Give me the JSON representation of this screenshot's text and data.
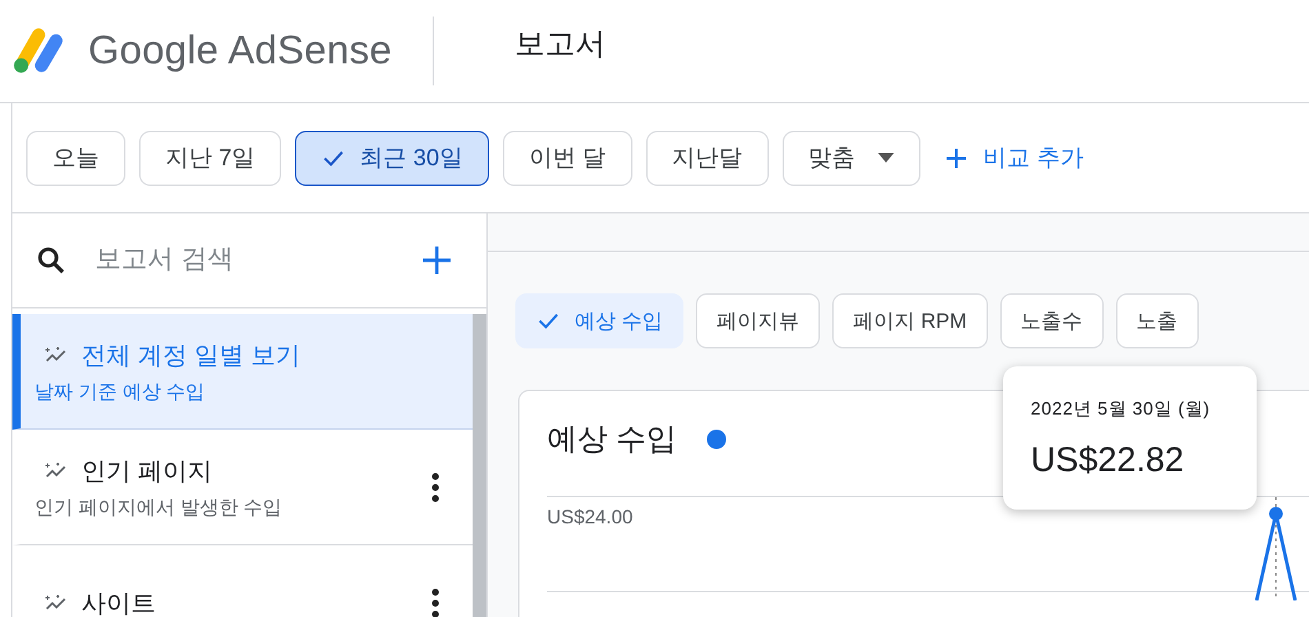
{
  "header": {
    "logo": "Google AdSense",
    "title": "보고서"
  },
  "date_chips": [
    {
      "label": "오늘",
      "selected": false
    },
    {
      "label": "지난 7일",
      "selected": false
    },
    {
      "label": "최근 30일",
      "selected": true
    },
    {
      "label": "이번 달",
      "selected": false
    },
    {
      "label": "지난달",
      "selected": false
    }
  ],
  "custom_dropdown": "맞춤",
  "compare_button": "비교 추가",
  "sidebar": {
    "search": {
      "placeholder": "보고서 검색"
    },
    "items": [
      {
        "title": "전체 계정 일별 보기",
        "subtitle": "날짜 기준 예상 수입",
        "selected": true
      },
      {
        "title": "인기 페이지",
        "subtitle": "인기 페이지에서 발생한 수입",
        "selected": false
      },
      {
        "title": "사이트",
        "selected": false
      }
    ]
  },
  "metrics": [
    {
      "label": "예상 수입",
      "selected": true
    },
    {
      "label": "페이지뷰",
      "selected": false
    },
    {
      "label": "페이지 RPM",
      "selected": false
    },
    {
      "label": "노출수",
      "selected": false
    },
    {
      "label": "노출",
      "selected": false
    }
  ],
  "chart": {
    "title": "예상 수입",
    "ytick": "US$24.00",
    "tooltip": {
      "date": "2022년 5월 30일 (월)",
      "value": "US$22.82"
    }
  }
}
